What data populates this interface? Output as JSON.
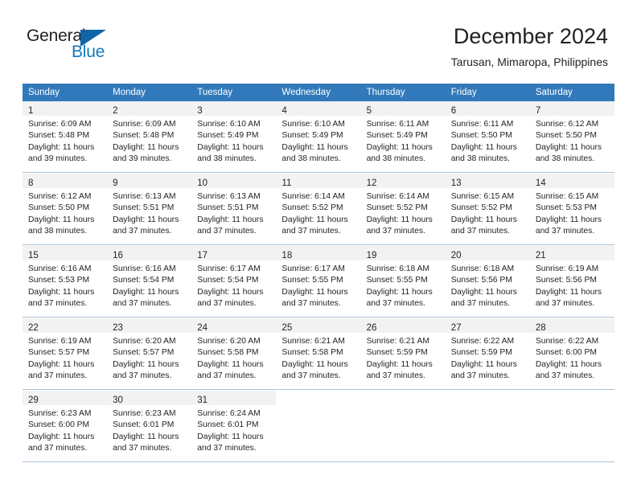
{
  "logo": {
    "word_general": "General",
    "word_blue": "Blue",
    "triangle_color": "#1064a8",
    "blue_color": "#1278be"
  },
  "header": {
    "title": "December 2024",
    "subtitle": "Tarusan, Mimaropa, Philippines"
  },
  "theme": {
    "header_row_bg": "#3179bb",
    "header_row_text": "#ffffff",
    "daynum_band_bg": "#f2f2f2",
    "row_divider": "#a9c2da",
    "body_text": "#231f20"
  },
  "weekdays": [
    "Sunday",
    "Monday",
    "Tuesday",
    "Wednesday",
    "Thursday",
    "Friday",
    "Saturday"
  ],
  "labels": {
    "sunrise_prefix": "Sunrise:",
    "sunset_prefix": "Sunset:",
    "daylight_prefix": "Daylight:"
  },
  "weeks": [
    [
      {
        "day": "1",
        "sunrise": "Sunrise: 6:09 AM",
        "sunset": "Sunset: 5:48 PM",
        "daylight_line1": "Daylight: 11 hours",
        "daylight_line2": "and 39 minutes."
      },
      {
        "day": "2",
        "sunrise": "Sunrise: 6:09 AM",
        "sunset": "Sunset: 5:48 PM",
        "daylight_line1": "Daylight: 11 hours",
        "daylight_line2": "and 39 minutes."
      },
      {
        "day": "3",
        "sunrise": "Sunrise: 6:10 AM",
        "sunset": "Sunset: 5:49 PM",
        "daylight_line1": "Daylight: 11 hours",
        "daylight_line2": "and 38 minutes."
      },
      {
        "day": "4",
        "sunrise": "Sunrise: 6:10 AM",
        "sunset": "Sunset: 5:49 PM",
        "daylight_line1": "Daylight: 11 hours",
        "daylight_line2": "and 38 minutes."
      },
      {
        "day": "5",
        "sunrise": "Sunrise: 6:11 AM",
        "sunset": "Sunset: 5:49 PM",
        "daylight_line1": "Daylight: 11 hours",
        "daylight_line2": "and 38 minutes."
      },
      {
        "day": "6",
        "sunrise": "Sunrise: 6:11 AM",
        "sunset": "Sunset: 5:50 PM",
        "daylight_line1": "Daylight: 11 hours",
        "daylight_line2": "and 38 minutes."
      },
      {
        "day": "7",
        "sunrise": "Sunrise: 6:12 AM",
        "sunset": "Sunset: 5:50 PM",
        "daylight_line1": "Daylight: 11 hours",
        "daylight_line2": "and 38 minutes."
      }
    ],
    [
      {
        "day": "8",
        "sunrise": "Sunrise: 6:12 AM",
        "sunset": "Sunset: 5:50 PM",
        "daylight_line1": "Daylight: 11 hours",
        "daylight_line2": "and 38 minutes."
      },
      {
        "day": "9",
        "sunrise": "Sunrise: 6:13 AM",
        "sunset": "Sunset: 5:51 PM",
        "daylight_line1": "Daylight: 11 hours",
        "daylight_line2": "and 37 minutes."
      },
      {
        "day": "10",
        "sunrise": "Sunrise: 6:13 AM",
        "sunset": "Sunset: 5:51 PM",
        "daylight_line1": "Daylight: 11 hours",
        "daylight_line2": "and 37 minutes."
      },
      {
        "day": "11",
        "sunrise": "Sunrise: 6:14 AM",
        "sunset": "Sunset: 5:52 PM",
        "daylight_line1": "Daylight: 11 hours",
        "daylight_line2": "and 37 minutes."
      },
      {
        "day": "12",
        "sunrise": "Sunrise: 6:14 AM",
        "sunset": "Sunset: 5:52 PM",
        "daylight_line1": "Daylight: 11 hours",
        "daylight_line2": "and 37 minutes."
      },
      {
        "day": "13",
        "sunrise": "Sunrise: 6:15 AM",
        "sunset": "Sunset: 5:52 PM",
        "daylight_line1": "Daylight: 11 hours",
        "daylight_line2": "and 37 minutes."
      },
      {
        "day": "14",
        "sunrise": "Sunrise: 6:15 AM",
        "sunset": "Sunset: 5:53 PM",
        "daylight_line1": "Daylight: 11 hours",
        "daylight_line2": "and 37 minutes."
      }
    ],
    [
      {
        "day": "15",
        "sunrise": "Sunrise: 6:16 AM",
        "sunset": "Sunset: 5:53 PM",
        "daylight_line1": "Daylight: 11 hours",
        "daylight_line2": "and 37 minutes."
      },
      {
        "day": "16",
        "sunrise": "Sunrise: 6:16 AM",
        "sunset": "Sunset: 5:54 PM",
        "daylight_line1": "Daylight: 11 hours",
        "daylight_line2": "and 37 minutes."
      },
      {
        "day": "17",
        "sunrise": "Sunrise: 6:17 AM",
        "sunset": "Sunset: 5:54 PM",
        "daylight_line1": "Daylight: 11 hours",
        "daylight_line2": "and 37 minutes."
      },
      {
        "day": "18",
        "sunrise": "Sunrise: 6:17 AM",
        "sunset": "Sunset: 5:55 PM",
        "daylight_line1": "Daylight: 11 hours",
        "daylight_line2": "and 37 minutes."
      },
      {
        "day": "19",
        "sunrise": "Sunrise: 6:18 AM",
        "sunset": "Sunset: 5:55 PM",
        "daylight_line1": "Daylight: 11 hours",
        "daylight_line2": "and 37 minutes."
      },
      {
        "day": "20",
        "sunrise": "Sunrise: 6:18 AM",
        "sunset": "Sunset: 5:56 PM",
        "daylight_line1": "Daylight: 11 hours",
        "daylight_line2": "and 37 minutes."
      },
      {
        "day": "21",
        "sunrise": "Sunrise: 6:19 AM",
        "sunset": "Sunset: 5:56 PM",
        "daylight_line1": "Daylight: 11 hours",
        "daylight_line2": "and 37 minutes."
      }
    ],
    [
      {
        "day": "22",
        "sunrise": "Sunrise: 6:19 AM",
        "sunset": "Sunset: 5:57 PM",
        "daylight_line1": "Daylight: 11 hours",
        "daylight_line2": "and 37 minutes."
      },
      {
        "day": "23",
        "sunrise": "Sunrise: 6:20 AM",
        "sunset": "Sunset: 5:57 PM",
        "daylight_line1": "Daylight: 11 hours",
        "daylight_line2": "and 37 minutes."
      },
      {
        "day": "24",
        "sunrise": "Sunrise: 6:20 AM",
        "sunset": "Sunset: 5:58 PM",
        "daylight_line1": "Daylight: 11 hours",
        "daylight_line2": "and 37 minutes."
      },
      {
        "day": "25",
        "sunrise": "Sunrise: 6:21 AM",
        "sunset": "Sunset: 5:58 PM",
        "daylight_line1": "Daylight: 11 hours",
        "daylight_line2": "and 37 minutes."
      },
      {
        "day": "26",
        "sunrise": "Sunrise: 6:21 AM",
        "sunset": "Sunset: 5:59 PM",
        "daylight_line1": "Daylight: 11 hours",
        "daylight_line2": "and 37 minutes."
      },
      {
        "day": "27",
        "sunrise": "Sunrise: 6:22 AM",
        "sunset": "Sunset: 5:59 PM",
        "daylight_line1": "Daylight: 11 hours",
        "daylight_line2": "and 37 minutes."
      },
      {
        "day": "28",
        "sunrise": "Sunrise: 6:22 AM",
        "sunset": "Sunset: 6:00 PM",
        "daylight_line1": "Daylight: 11 hours",
        "daylight_line2": "and 37 minutes."
      }
    ],
    [
      {
        "day": "29",
        "sunrise": "Sunrise: 6:23 AM",
        "sunset": "Sunset: 6:00 PM",
        "daylight_line1": "Daylight: 11 hours",
        "daylight_line2": "and 37 minutes."
      },
      {
        "day": "30",
        "sunrise": "Sunrise: 6:23 AM",
        "sunset": "Sunset: 6:01 PM",
        "daylight_line1": "Daylight: 11 hours",
        "daylight_line2": "and 37 minutes."
      },
      {
        "day": "31",
        "sunrise": "Sunrise: 6:24 AM",
        "sunset": "Sunset: 6:01 PM",
        "daylight_line1": "Daylight: 11 hours",
        "daylight_line2": "and 37 minutes."
      },
      null,
      null,
      null,
      null
    ]
  ]
}
